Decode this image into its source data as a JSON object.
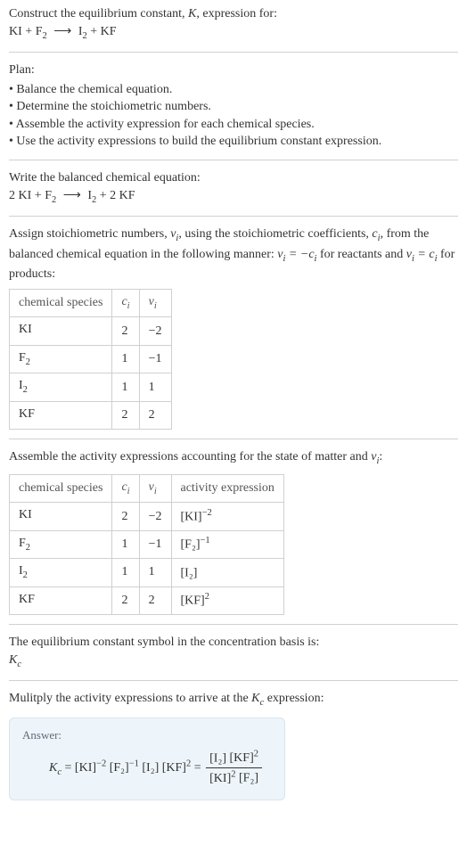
{
  "intro": {
    "line1_pre": "Construct the equilibrium constant, ",
    "line1_K": "K",
    "line1_post": ", expression for:",
    "eq_lhs_a": "KI",
    "eq_plus": " + ",
    "eq_lhs_b": "F",
    "eq_lhs_b_sub": "2",
    "eq_arrow": "⟶",
    "eq_rhs_a": "I",
    "eq_rhs_a_sub": "2",
    "eq_rhs_b": "KF"
  },
  "plan": {
    "heading": "Plan:",
    "items": [
      "Balance the chemical equation.",
      "Determine the stoichiometric numbers.",
      "Assemble the activity expression for each chemical species.",
      "Use the activity expressions to build the equilibrium constant expression."
    ]
  },
  "balanced": {
    "heading": "Write the balanced chemical equation:",
    "c1": "2 KI",
    "plus": " + ",
    "c2a": "F",
    "c2sub": "2",
    "arrow": "⟶",
    "c3a": "I",
    "c3sub": "2",
    "c4": "2 KF"
  },
  "stoich_text": {
    "p1": "Assign stoichiometric numbers, ",
    "nu_i": "ν",
    "nu_i_sub": "i",
    "p2": ", using the stoichiometric coefficients, ",
    "c_i": "c",
    "c_i_sub": "i",
    "p3": ", from the balanced chemical equation in the following manner: ",
    "rel1a": "ν",
    "rel1a_sub": "i",
    "rel1eq": " = −",
    "rel1b": "c",
    "rel1b_sub": "i",
    "p4": " for reactants and ",
    "rel2a": "ν",
    "rel2a_sub": "i",
    "rel2eq": " = ",
    "rel2b": "c",
    "rel2b_sub": "i",
    "p5": " for products:"
  },
  "table1": {
    "h1": "chemical species",
    "h2": "c",
    "h2_sub": "i",
    "h3": "ν",
    "h3_sub": "i",
    "rows": [
      {
        "sp": "KI",
        "sp_sub": "",
        "c": "2",
        "nu": "−2"
      },
      {
        "sp": "F",
        "sp_sub": "2",
        "c": "1",
        "nu": "−1"
      },
      {
        "sp": "I",
        "sp_sub": "2",
        "c": "1",
        "nu": "1"
      },
      {
        "sp": "KF",
        "sp_sub": "",
        "c": "2",
        "nu": "2"
      }
    ]
  },
  "assemble_text": {
    "p1": "Assemble the activity expressions accounting for the state of matter and ",
    "nu": "ν",
    "nu_sub": "i",
    "p2": ":"
  },
  "table2": {
    "h1": "chemical species",
    "h2": "c",
    "h2_sub": "i",
    "h3": "ν",
    "h3_sub": "i",
    "h4": "activity expression",
    "rows": [
      {
        "sp": "KI",
        "sp_sub": "",
        "c": "2",
        "nu": "−2",
        "act_base": "[KI]",
        "act_exp": "−2"
      },
      {
        "sp": "F",
        "sp_sub": "2",
        "c": "1",
        "nu": "−1",
        "act_base": "[F₂]",
        "act_exp": "−1"
      },
      {
        "sp": "I",
        "sp_sub": "2",
        "c": "1",
        "nu": "1",
        "act_base": "[I₂]",
        "act_exp": ""
      },
      {
        "sp": "KF",
        "sp_sub": "",
        "c": "2",
        "nu": "2",
        "act_base": "[KF]",
        "act_exp": "2"
      }
    ]
  },
  "kc_symbol": {
    "line": "The equilibrium constant symbol in the concentration basis is:",
    "K": "K",
    "K_sub": "c"
  },
  "multiply_line": {
    "p1": "Mulitply the activity expressions to arrive at the ",
    "K": "K",
    "K_sub": "c",
    "p2": " expression:"
  },
  "answer": {
    "label": "Answer:",
    "K": "K",
    "K_sub": "c",
    "eq": " = ",
    "t1": "[KI]",
    "t1e": "−2",
    "t2": "[F₂]",
    "t2e": "−1",
    "t3": "[I₂]",
    "t4": "[KF]",
    "t4e": "2",
    "eq2": " = ",
    "num1": "[I₂]",
    "num2": "[KF]",
    "num2e": "2",
    "den1": "[KI]",
    "den1e": "2",
    "den2": "[F₂]"
  }
}
